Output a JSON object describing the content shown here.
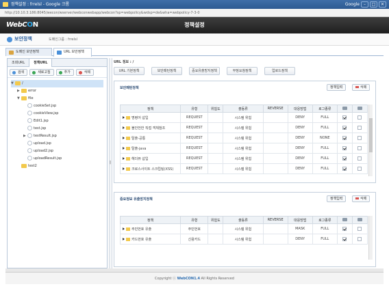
{
  "window": {
    "title": "정책설정 : frrelsl - Google 크롬",
    "brand": "Google",
    "min": "–",
    "max": "□",
    "close": "✕"
  },
  "address": {
    "url": "http://10.10.3.186:8045/wecon/wserver/webconwebapp/webcon?sp=webpolicy&wdsp=de&wha=webpolicy-7-3-0"
  },
  "app": {
    "logo_a": "WebC",
    "logo_b": "O",
    "logo_c": "N",
    "title": "정책설정"
  },
  "crumb": {
    "section": "보안정책",
    "path": "도메인그룹 : frrelsl"
  },
  "tabs": [
    {
      "label": "도메인 보안정책"
    },
    {
      "label": "URL 보안정책"
    }
  ],
  "left": {
    "tabs": [
      "조회URL",
      "정책URL"
    ],
    "toolbar": [
      {
        "label": "검색",
        "color": "#4a90d9"
      },
      {
        "label": "새로고침",
        "color": "#3aa655"
      },
      {
        "label": "추가",
        "color": "#3aa655"
      },
      {
        "label": "삭제",
        "color": "#d9534f"
      }
    ],
    "tree": [
      {
        "label": "/",
        "kind": "folder",
        "indent": 0,
        "toggle": "▼",
        "selected": true
      },
      {
        "label": "error",
        "kind": "folder",
        "indent": 1,
        "toggle": "▶"
      },
      {
        "label": "file",
        "kind": "folder",
        "indent": 1,
        "toggle": "▼"
      },
      {
        "label": "cookieSet.jsp",
        "kind": "file",
        "indent": 2,
        "toggle": ""
      },
      {
        "label": "cookieView.jsp",
        "kind": "file",
        "indent": 2,
        "toggle": ""
      },
      {
        "label": "Edit1.jsp",
        "kind": "file",
        "indent": 2,
        "toggle": ""
      },
      {
        "label": "test.jsp",
        "kind": "file",
        "indent": 2,
        "toggle": ""
      },
      {
        "label": "testResult.jsp",
        "kind": "file",
        "indent": 2,
        "toggle": "▶"
      },
      {
        "label": "upload.jsp",
        "kind": "file",
        "indent": 2,
        "toggle": ""
      },
      {
        "label": "upload2.jsp",
        "kind": "file",
        "indent": 2,
        "toggle": ""
      },
      {
        "label": "uploadResult.jsp",
        "kind": "file",
        "indent": 2,
        "toggle": ""
      },
      {
        "label": "test2",
        "kind": "folder",
        "indent": 1,
        "toggle": ""
      }
    ]
  },
  "right": {
    "url_label": "URL 정보 : /",
    "policy_buttons": [
      "URL 기본정책",
      "보안패턴정책",
      "중요유출방지정책",
      "부정요청정책",
      "업로드정책"
    ],
    "panel1": {
      "title": "보안패턴정책",
      "add": "정책입력",
      "del": "삭제",
      "headers": [
        "정책",
        "유형",
        "위험도",
        "출동류",
        "REVERSE",
        "대응방법",
        "로그종류"
      ],
      "rows": [
        {
          "name": "명령어 삽입",
          "type": "REQUEST",
          "risk": "",
          "cat": "시스템 위험",
          "rev": "",
          "act": "DENY",
          "log": "FULL",
          "c1": true,
          "c2": false
        },
        {
          "name": "불안전한 직접 객체참조",
          "type": "REQUEST",
          "risk": "",
          "cat": "시스템 위험",
          "rev": "",
          "act": "DENY",
          "log": "FULL",
          "c1": true,
          "c2": false
        },
        {
          "name": "탈출-공통",
          "type": "REQUEST",
          "risk": "",
          "cat": "시스템 위험",
          "rev": "",
          "act": "DENY",
          "log": "NONE",
          "c1": true,
          "c2": false
        },
        {
          "name": "탈출-java",
          "type": "REQUEST",
          "risk": "",
          "cat": "시스템 위험",
          "rev": "",
          "act": "DENY",
          "log": "FULL",
          "c1": true,
          "c2": false
        },
        {
          "name": "헤더뷰 삽입",
          "type": "REQUEST",
          "risk": "",
          "cat": "시스템 위험",
          "rev": "",
          "act": "DENY",
          "log": "FULL",
          "c1": true,
          "c2": false
        },
        {
          "name": "크로스사이트 스크립팅(XSS)",
          "type": "REQUEST",
          "risk": "",
          "cat": "시스템 위험",
          "rev": "",
          "act": "DENY",
          "log": "FULL",
          "c1": true,
          "c2": false
        }
      ]
    },
    "panel2": {
      "title": "중요정보 유출방지정책",
      "add": "정책입력",
      "del": "삭제",
      "headers": [
        "정책",
        "유형",
        "위험도",
        "출동류",
        "REVERSE",
        "대응방법",
        "로그종류"
      ],
      "rows": [
        {
          "name": "주민번호 유출",
          "type": "주민번호",
          "risk": "",
          "cat": "시스템 위험",
          "rev": "",
          "act": "MASK",
          "log": "FULL",
          "c1": true,
          "c2": false
        },
        {
          "name": "카드번호 유출",
          "type": "신용카드",
          "risk": "",
          "cat": "시스템 위험",
          "rev": "",
          "act": "DENY",
          "log": "FULL",
          "c1": true,
          "c2": false
        }
      ]
    }
  },
  "footer": {
    "prefix": "Copyright ⓒ",
    "brand": "WebCON1.4",
    "suffix": "All Rights Reserved"
  }
}
